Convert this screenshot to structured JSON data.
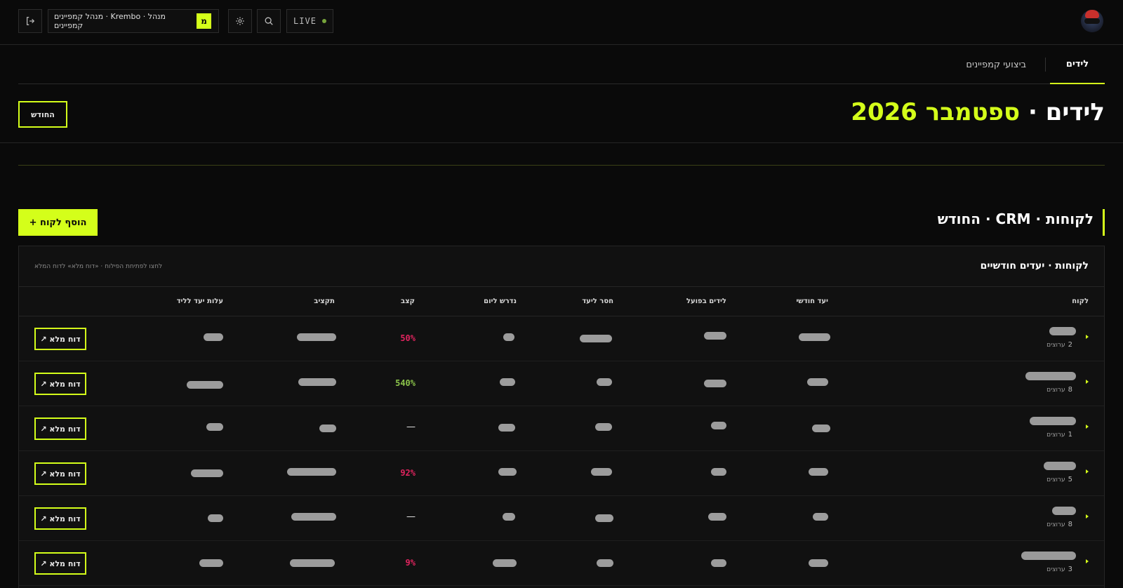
{
  "topbar": {
    "live_label": "LIVE",
    "workspace_badge": "מ",
    "workspace_label": "מנהל קמפיינים · Krembo · מנהל קמפיינים",
    "colors": {
      "accent": "#d4ff1a",
      "live_dot": "#76a43b"
    },
    "icons": [
      "logout-icon",
      "settings-gear-icon",
      "search-icon",
      "user-avatar"
    ]
  },
  "tabs": [
    {
      "label": "לידים",
      "active": true
    },
    {
      "label": "ביצועי קמפיינים",
      "active": false
    }
  ],
  "page": {
    "title_main": "לידים ·",
    "title_accent": "ספטמבר 2026",
    "month_button": "החודש"
  },
  "section": {
    "title": "לקוחות · CRM · החודש",
    "add_button": "+ הוסף לקוח"
  },
  "card": {
    "title": "לקוחות · יעדים חודשיים",
    "hint": "לחצו לפתיחת הפילוח · «דוח מלא» לדוח המלא",
    "columns": [
      "לקוח",
      "יעד חודשי",
      "לידים בפועל",
      "חסר ליעד",
      "נדרש ליום",
      "קצב",
      "תקציב",
      "עלות יעד לליד"
    ],
    "rows": [
      {
        "count": "2",
        "sub": "ערוצים",
        "pace": "50%",
        "pace_color": "#e0245e",
        "report": "דוח מלא ↗"
      },
      {
        "count": "8",
        "sub": "ערוצים",
        "pace": "540%",
        "pace_color": "#8bc34a",
        "report": "דוח מלא ↗"
      },
      {
        "count": "1",
        "sub": "ערוצים",
        "pace": "—",
        "pace_color": "#e8e8e8",
        "report": "דוח מלא ↗"
      },
      {
        "count": "5",
        "sub": "ערוצים",
        "pace": "92%",
        "pace_color": "#e0245e",
        "report": "דוח מלא ↗"
      },
      {
        "count": "8",
        "sub": "ערוצים",
        "pace": "—",
        "pace_color": "#e8e8e8",
        "report": "דוח מלא ↗"
      },
      {
        "count": "3",
        "sub": "ערוצים",
        "pace": "9%",
        "pace_color": "#e0245e",
        "report": "דוח מלא ↗"
      }
    ]
  }
}
